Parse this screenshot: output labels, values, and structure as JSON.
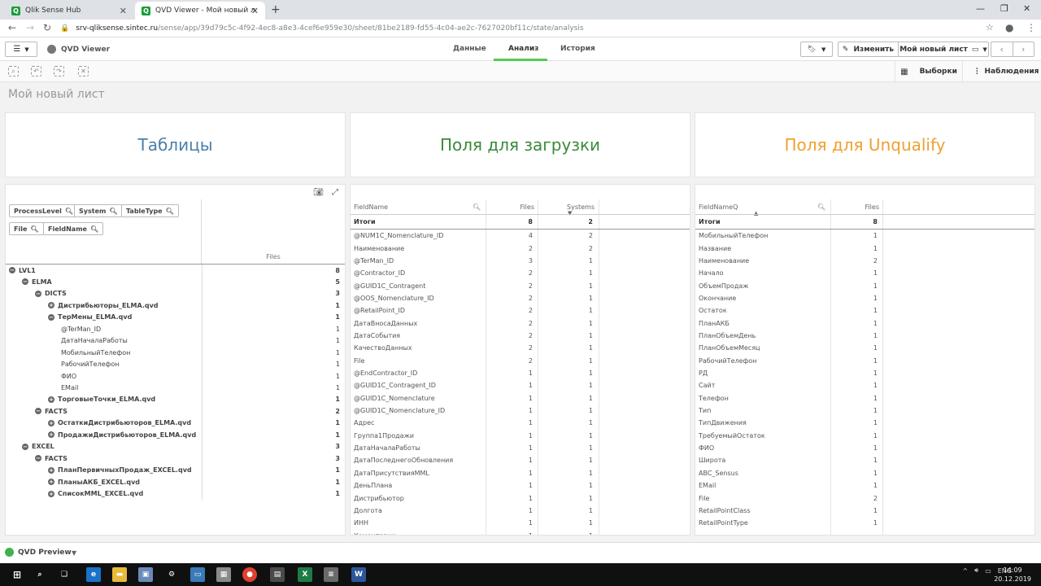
{
  "browser": {
    "tabs": [
      {
        "title": "Qlik Sense Hub",
        "active": false
      },
      {
        "title": "QVD Viewer - Мой новый лист | ",
        "active": true
      }
    ],
    "url_host": "srv-qliksense.sintec.ru",
    "url_path": "/sense/app/39d79c5c-4f92-4ec8-a8e3-4cef6e959e30/sheet/81be2189-fd55-4c04-ae2c-7627020bf11c/state/analysis"
  },
  "app": {
    "name": "QVD Viewer",
    "nav": [
      "Данные",
      "Анализ",
      "История"
    ],
    "edit_label": "Изменить",
    "sheet_select": "Мой новый лист",
    "selections_label": "Выборки",
    "observations_label": "Наблюдения",
    "sheet_title": "Мой новый лист"
  },
  "cards": [
    {
      "text": "Таблицы",
      "color": "#4b7fa8"
    },
    {
      "text": "Поля для загрузки",
      "color": "#3a8a3a"
    },
    {
      "text": "Поля для Unqualify",
      "color": "#f0a030"
    }
  ],
  "pivot": {
    "chips": [
      "ProcessLevel",
      "System",
      "TableType",
      "File",
      "FieldName"
    ],
    "measure": "Files",
    "rows": [
      {
        "level": 0,
        "label": "LVL1",
        "value": "8",
        "toggle": "minus",
        "bold": true
      },
      {
        "level": 1,
        "label": "ELMA",
        "value": "5",
        "toggle": "minus",
        "bold": true
      },
      {
        "level": 2,
        "label": "DICTS",
        "value": "3",
        "toggle": "minus",
        "bold": true
      },
      {
        "level": 3,
        "label": "Дистрибьюторы_ELMA.qvd",
        "value": "1",
        "toggle": "plus",
        "bold": true
      },
      {
        "level": 3,
        "label": "ТерМены_ELMA.qvd",
        "value": "1",
        "toggle": "minus",
        "bold": true
      },
      {
        "level": 4,
        "label": "@TerMan_ID",
        "value": "1",
        "toggle": "",
        "bold": false
      },
      {
        "level": 4,
        "label": "ДатаНачалаРаботы",
        "value": "1",
        "toggle": "",
        "bold": false
      },
      {
        "level": 4,
        "label": "МобильныйТелефон",
        "value": "1",
        "toggle": "",
        "bold": false
      },
      {
        "level": 4,
        "label": "РабочийТелефон",
        "value": "1",
        "toggle": "",
        "bold": false
      },
      {
        "level": 4,
        "label": "ФИО",
        "value": "1",
        "toggle": "",
        "bold": false
      },
      {
        "level": 4,
        "label": "EMail",
        "value": "1",
        "toggle": "",
        "bold": false
      },
      {
        "level": 3,
        "label": "ТорговыеТочки_ELMA.qvd",
        "value": "1",
        "toggle": "plus",
        "bold": true
      },
      {
        "level": 2,
        "label": "FACTS",
        "value": "2",
        "toggle": "minus",
        "bold": true
      },
      {
        "level": 3,
        "label": "ОстаткиДистрибьюторов_ELMA.qvd",
        "value": "1",
        "toggle": "plus",
        "bold": true
      },
      {
        "level": 3,
        "label": "ПродажиДистрибьюторов_ELMA.qvd",
        "value": "1",
        "toggle": "plus",
        "bold": true
      },
      {
        "level": 1,
        "label": "EXCEL",
        "value": "3",
        "toggle": "minus",
        "bold": true
      },
      {
        "level": 2,
        "label": "FACTS",
        "value": "3",
        "toggle": "minus",
        "bold": true
      },
      {
        "level": 3,
        "label": "ПланПервичныхПродаж_EXCEL.qvd",
        "value": "1",
        "toggle": "plus",
        "bold": true
      },
      {
        "level": 3,
        "label": "ПланыАКБ_EXCEL.qvd",
        "value": "1",
        "toggle": "plus",
        "bold": true
      },
      {
        "level": 3,
        "label": "СписокMML_EXCEL.qvd",
        "value": "1",
        "toggle": "plus",
        "bold": true
      }
    ]
  },
  "table2": {
    "headers": [
      "FieldName",
      "Files",
      "Systems"
    ],
    "total_label": "Итоги",
    "total_files": "8",
    "total_systems": "2",
    "rows": [
      [
        "@NUM1C_Nomenclature_ID",
        "4",
        "2"
      ],
      [
        "Наименование",
        "2",
        "2"
      ],
      [
        "@TerMan_ID",
        "3",
        "1"
      ],
      [
        "@Contractor_ID",
        "2",
        "1"
      ],
      [
        "@GUID1C_Contragent",
        "2",
        "1"
      ],
      [
        "@OOS_Nomenclature_ID",
        "2",
        "1"
      ],
      [
        "@RetailPoint_ID",
        "2",
        "1"
      ],
      [
        "ДатаВносаДанных",
        "2",
        "1"
      ],
      [
        "ДатаСобытия",
        "2",
        "1"
      ],
      [
        "КачествоДанных",
        "2",
        "1"
      ],
      [
        "File",
        "2",
        "1"
      ],
      [
        "@EndContractor_ID",
        "1",
        "1"
      ],
      [
        "@GUID1C_Contragent_ID",
        "1",
        "1"
      ],
      [
        "@GUID1C_Nomenclature",
        "1",
        "1"
      ],
      [
        "@GUID1C_Nomenclature_ID",
        "1",
        "1"
      ],
      [
        "Адрес",
        "1",
        "1"
      ],
      [
        "Группа1Продажи",
        "1",
        "1"
      ],
      [
        "ДатаНачалаРаботы",
        "1",
        "1"
      ],
      [
        "ДатаПоследнегоОбновления",
        "1",
        "1"
      ],
      [
        "ДатаПрисутствияMML",
        "1",
        "1"
      ],
      [
        "ДеньПлана",
        "1",
        "1"
      ],
      [
        "Дистрибьютор",
        "1",
        "1"
      ],
      [
        "Долгота",
        "1",
        "1"
      ],
      [
        "ИНН",
        "1",
        "1"
      ],
      [
        "Коментарии",
        "1",
        "1"
      ]
    ]
  },
  "table3": {
    "headers": [
      "FieldNameQ",
      "Files"
    ],
    "total_label": "Итоги",
    "total_files": "8",
    "rows": [
      [
        "МобильныйТелефон",
        "1"
      ],
      [
        "Название",
        "1"
      ],
      [
        "Наименование",
        "2"
      ],
      [
        "Начало",
        "1"
      ],
      [
        "ОбъемПродаж",
        "1"
      ],
      [
        "Окончание",
        "1"
      ],
      [
        "Остаток",
        "1"
      ],
      [
        "ПланАКБ",
        "1"
      ],
      [
        "ПланОбъемДень",
        "1"
      ],
      [
        "ПланОбъемМесяц",
        "1"
      ],
      [
        "РабочийТелефон",
        "1"
      ],
      [
        "РД",
        "1"
      ],
      [
        "Сайт",
        "1"
      ],
      [
        "Телефон",
        "1"
      ],
      [
        "Тип",
        "1"
      ],
      [
        "ТипДвижения",
        "1"
      ],
      [
        "ТребуемыйОстаток",
        "1"
      ],
      [
        "ФИО",
        "1"
      ],
      [
        "Широта",
        "1"
      ],
      [
        "ABC_Sensus",
        "1"
      ],
      [
        "EMail",
        "1"
      ],
      [
        "File",
        "2"
      ],
      [
        "RetailPointClass",
        "1"
      ],
      [
        "RetailPointType",
        "1"
      ]
    ]
  },
  "bottom": {
    "bookmark": "QVD Preview"
  },
  "taskbar": {
    "lang": "ENG",
    "time": "14:09",
    "date": "20.12.2019"
  }
}
